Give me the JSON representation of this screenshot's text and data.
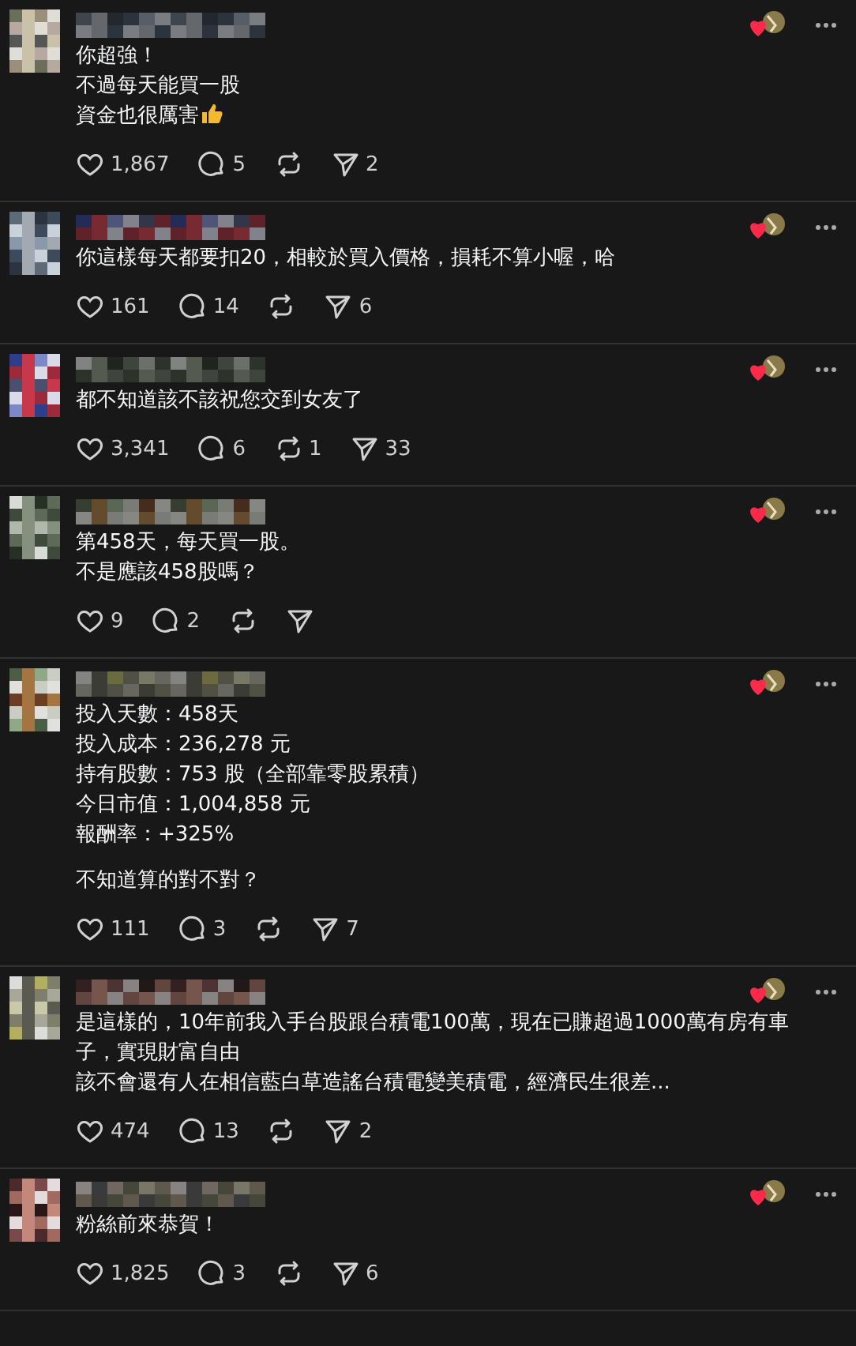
{
  "comments": [
    {
      "lines": [
        {
          "text": "你超強！"
        },
        {
          "text": "不過每天能買一股"
        },
        {
          "text": "資金也很厲害",
          "kind": "thumbs_up"
        }
      ],
      "liked_by_author": true,
      "likes": "1,867",
      "replies": "5",
      "shares": "2"
    },
    {
      "lines": [
        {
          "text": "你這樣每天都要扣20，相較於買入價格，損耗不算小喔，哈"
        }
      ],
      "liked_by_author": true,
      "likes": "161",
      "replies": "14",
      "shares": "6"
    },
    {
      "lines": [
        {
          "text": "都不知道該不該祝您交到女友了"
        }
      ],
      "liked_by_author": true,
      "likes": "3,341",
      "replies": "6",
      "reposts": "1",
      "shares": "33"
    },
    {
      "lines": [
        {
          "text": "第458天，每天買一股。"
        },
        {
          "text": "不是應該458股嗎？"
        }
      ],
      "liked_by_author": true,
      "likes": "9",
      "replies": "2"
    },
    {
      "lines": [
        {
          "text": "投入天數：458天"
        },
        {
          "text": "投入成本：236,278 元"
        },
        {
          "text": "持有股數：753 股（全部靠零股累積）"
        },
        {
          "text": "今日市值：1,004,858 元"
        },
        {
          "text": "報酬率：+325%"
        },
        {
          "text": "不知道算的對不對？",
          "gap": true
        }
      ],
      "liked_by_author": true,
      "likes": "111",
      "replies": "3",
      "shares": "7"
    },
    {
      "lines": [
        {
          "text": "是這樣的，10年前我入手台股跟台積電100萬，現在已賺超過1000萬有房有車子，實現財富自由"
        },
        {
          "text": "該不會還有人在相信藍白草造謠台積電變美積電，經濟民生很差..."
        }
      ],
      "liked_by_author": true,
      "likes": "474",
      "replies": "13",
      "shares": "2"
    },
    {
      "lines": [
        {
          "text": "粉絲前來恭賀！"
        }
      ],
      "liked_by_author": true,
      "likes": "1,825",
      "replies": "3",
      "shares": "6"
    }
  ]
}
